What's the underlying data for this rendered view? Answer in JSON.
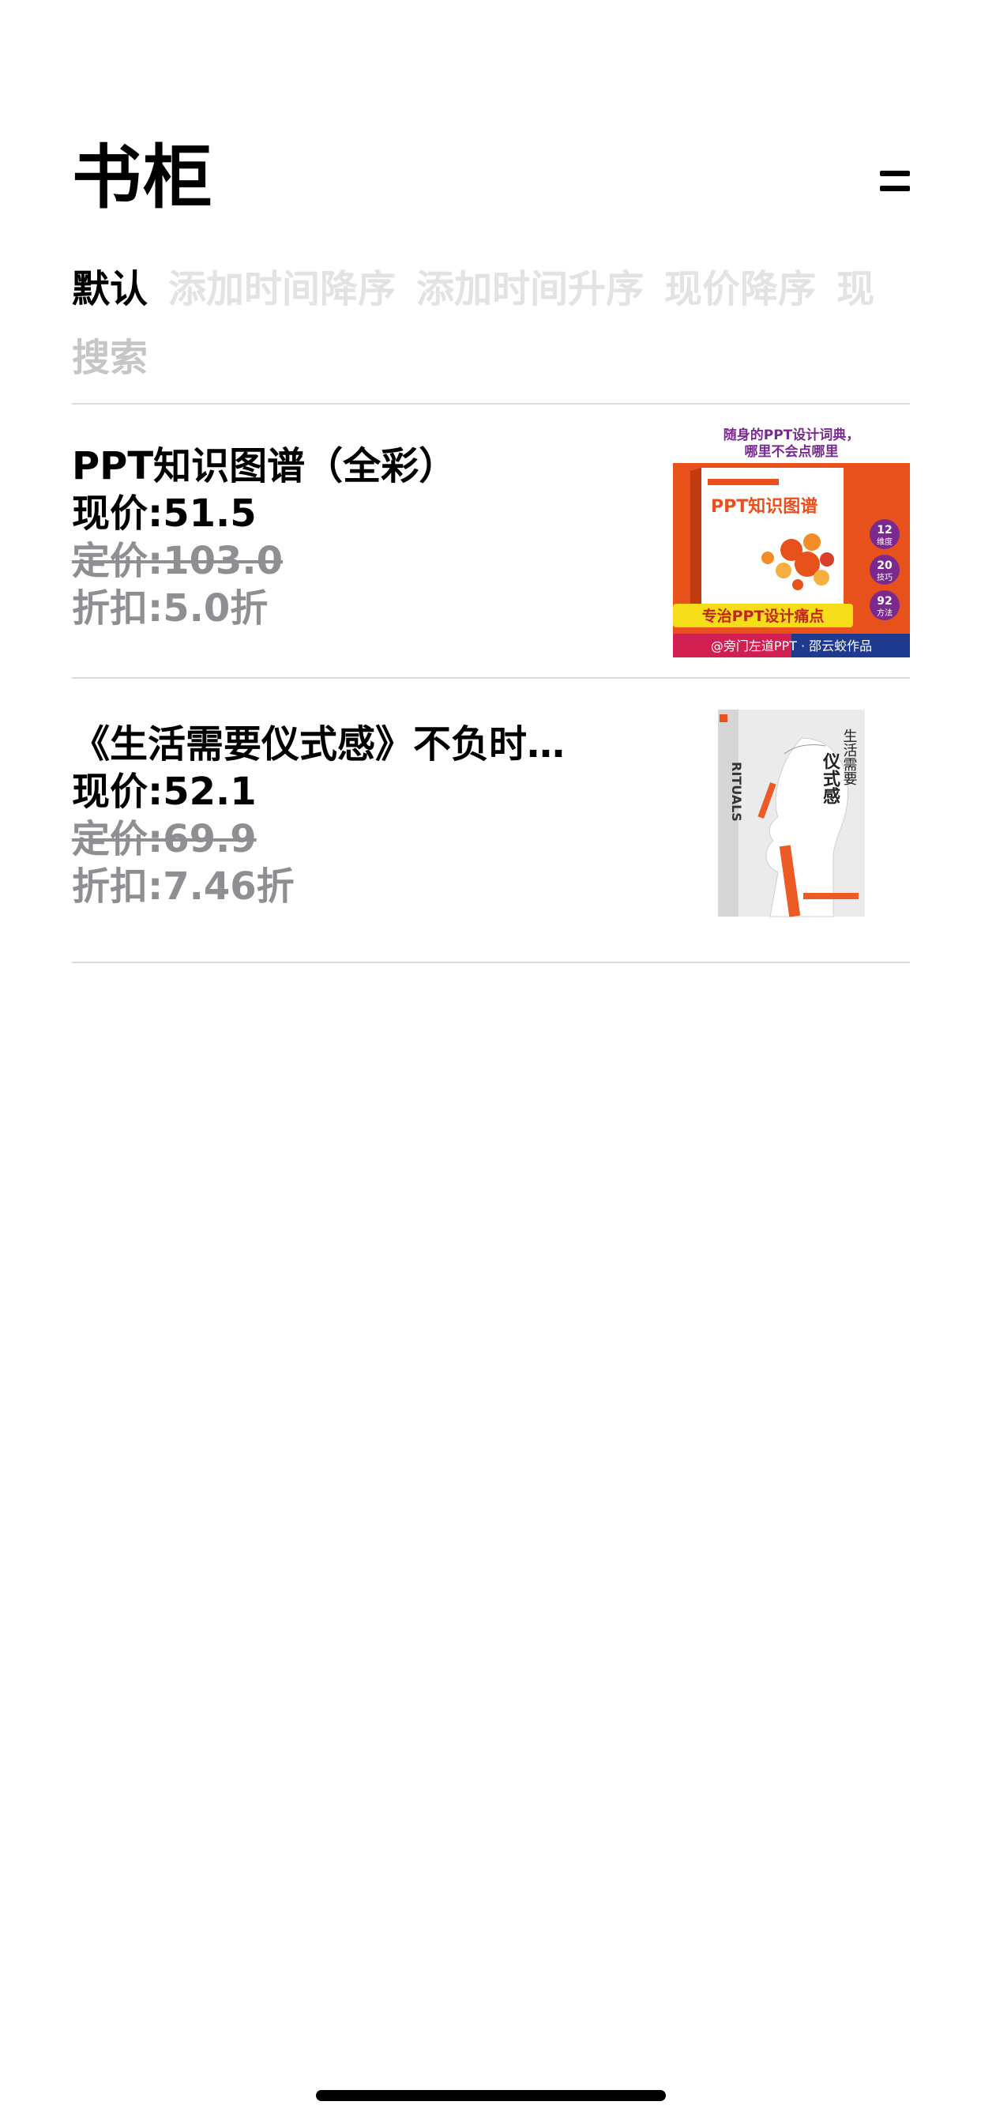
{
  "header": {
    "title": "书柜",
    "menu_icon": "hamburger-menu-icon"
  },
  "sort_tabs": [
    {
      "label": "默认",
      "active": true
    },
    {
      "label": "添加时间降序",
      "active": false
    },
    {
      "label": "添加时间升序",
      "active": false
    },
    {
      "label": "现价降序",
      "active": false
    },
    {
      "label": "现",
      "active": false
    }
  ],
  "search": {
    "label": "搜索"
  },
  "books": [
    {
      "title": "PPT知识图谱（全彩）",
      "price": "现价:51.5",
      "list_price": "定价:103.0",
      "discount": "折扣:5.0折",
      "cover": {
        "tagline_line1": "随身的PPT设计词典，",
        "tagline_line2": "哪里不会点哪里",
        "book_name": "PPT知识图谱",
        "badge1": "12",
        "badge1_sub": "维度",
        "badge2": "20",
        "badge2_sub": "技巧",
        "badge3": "92",
        "badge3_sub": "方法",
        "banner": "专治PPT设计痛点",
        "footer": "@旁门左道PPT · 邵云蛟作品",
        "accent_color": "#e8501c",
        "banner_color": "#f5dd1a",
        "footer_color": "#1d3a8f",
        "badge_color": "#7a2a8e"
      }
    },
    {
      "title": "《生活需要仪式感》不负时…",
      "price": "现价:52.1",
      "list_price": "定价:69.9",
      "discount": "折扣:7.46折",
      "cover": {
        "spine_title": "RITUALS",
        "title_line1": "生活需要",
        "title_line2": "仪式感",
        "accent_color": "#ee5a24"
      }
    }
  ]
}
